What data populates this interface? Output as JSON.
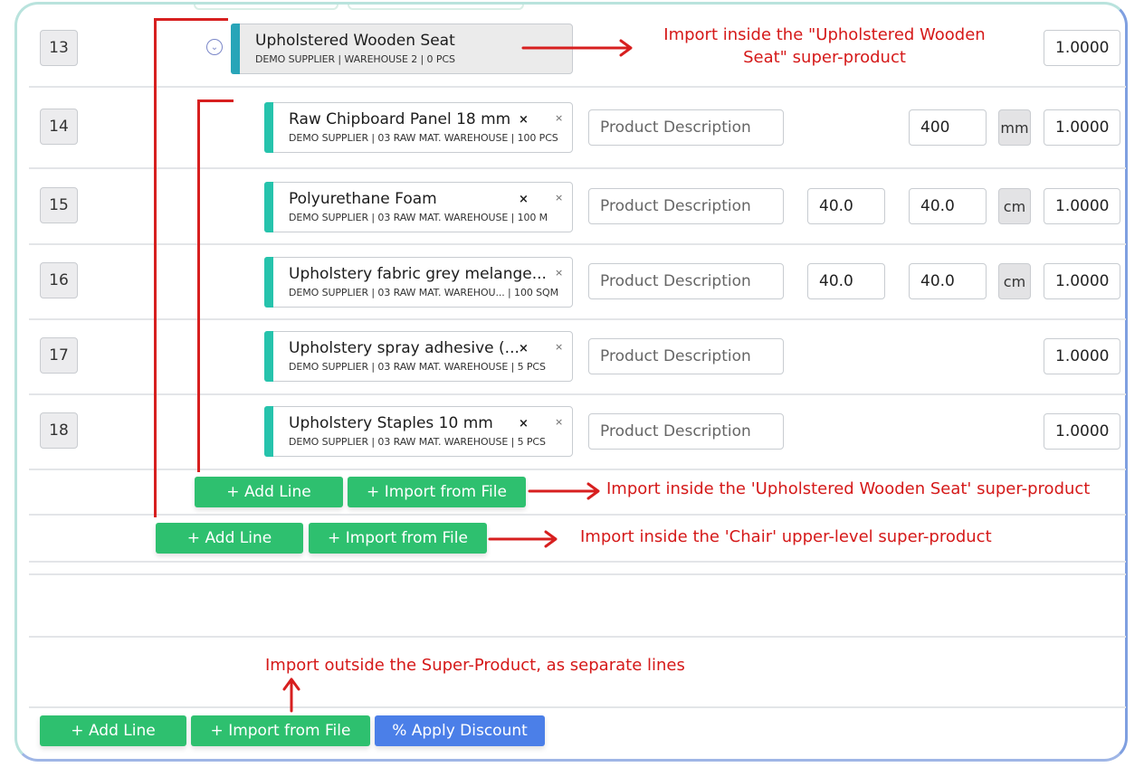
{
  "rows": [
    {
      "number": "13",
      "name": "Upholstered Wooden Seat",
      "sub": "DEMO SUPPLIER | WAREHOUSE 2 | 0 PCS",
      "qty": "1.0000"
    },
    {
      "number": "14",
      "name": "Raw Chipboard Panel 18 mm",
      "sub": "DEMO SUPPLIER  | 03 RAW MAT. WAREHOUSE | 100 PCS",
      "desc_placeholder": "Product Description",
      "dim2": "400",
      "unit": "mm",
      "qty": "1.0000"
    },
    {
      "number": "15",
      "name": "Polyurethane Foam",
      "sub": "DEMO SUPPLIER  | 03 RAW MAT. WAREHOUSE | 100 M",
      "desc_placeholder": "Product Description",
      "dim1": "40.0",
      "dim2": "40.0",
      "unit": "cm",
      "qty": "1.0000"
    },
    {
      "number": "16",
      "name": "Upholstery fabric grey melange...",
      "sub": "DEMO SUPPLIER  | 03 RAW MAT. WAREHOU... | 100 SQM",
      "desc_placeholder": "Product Description",
      "dim1": "40.0",
      "dim2": "40.0",
      "unit": "cm",
      "qty": "1.0000"
    },
    {
      "number": "17",
      "name": "Upholstery spray adhesive (...",
      "sub": "DEMO SUPPLIER  | 03 RAW MAT. WAREHOUSE | 5 PCS",
      "desc_placeholder": "Product Description",
      "qty": "1.0000"
    },
    {
      "number": "18",
      "name": "Upholstery Staples 10 mm",
      "sub": "DEMO SUPPLIER  | 03 RAW MAT. WAREHOUSE | 5 PCS",
      "desc_placeholder": "Product Description",
      "qty": "1.0000"
    }
  ],
  "close_marks": {
    "bold": "×",
    "light": "×"
  },
  "buttons": {
    "add_line": "+ Add Line",
    "import_file": "+ Import from File",
    "apply_discount": "% Apply Discount"
  },
  "annotations": {
    "seat_line1": "Import inside the \"Upholstered Wooden",
    "seat_line2": "Seat\" super-product",
    "inner_import": "Import inside the 'Upholstered Wooden Seat' super-product",
    "chair_import": "Import inside the 'Chair' upper-level super-product",
    "outside_import": "Import outside the Super-Product, as separate lines"
  },
  "colors": {
    "button_green": "#2ec06f",
    "button_blue": "#4b7fe8",
    "annotation_red": "#d51919",
    "accent_teal": "#26c3ac"
  }
}
